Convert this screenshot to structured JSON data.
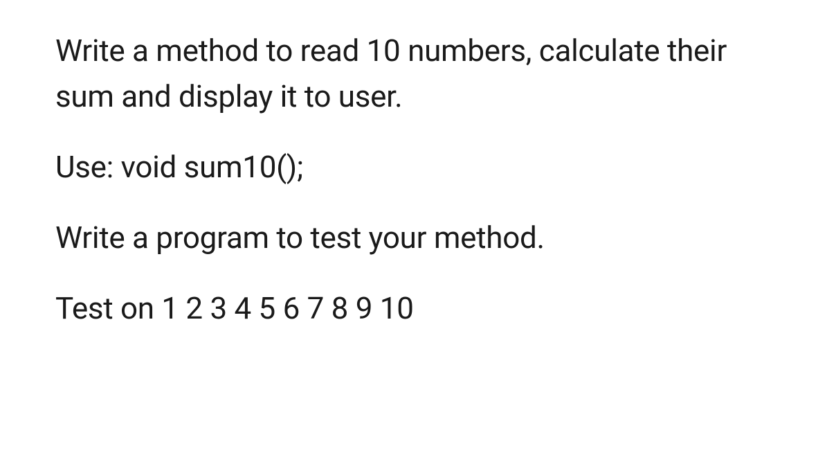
{
  "paragraphs": {
    "p1": "Write a method to read 10 numbers, calculate their sum and display it to user.",
    "p2": "Use: void sum10();",
    "p3": "Write a program to test your method.",
    "p4": "Test on 1 2 3 4 5 6 7 8 9 10"
  }
}
